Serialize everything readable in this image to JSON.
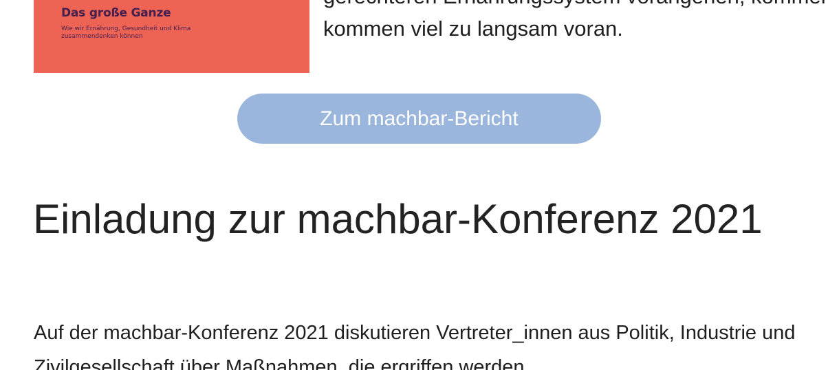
{
  "cover": {
    "title": "Das große Ganze",
    "subtitle": "Wie wir Ernährung, Gesundheit und Klima zusammendenken können"
  },
  "intro": {
    "line_cut": "gerechteren Ernährungssystem vorangehen, kommen",
    "line_full": "kommen viel zu langsam voran."
  },
  "cta": {
    "label": "Zum machbar-Bericht"
  },
  "section": {
    "title": "Einladung zur machbar-Konferenz 2021",
    "text": "Auf der machbar-Konferenz 2021 diskutieren Vertreter_innen aus Politik, Industrie und Zivilgesellschaft über Maßnahmen, die ergriffen werden"
  },
  "colors": {
    "cover_bg": "#ee6454",
    "cover_text": "#46204f",
    "cta_bg": "#9bb6dc",
    "cta_text": "#ffffff"
  }
}
